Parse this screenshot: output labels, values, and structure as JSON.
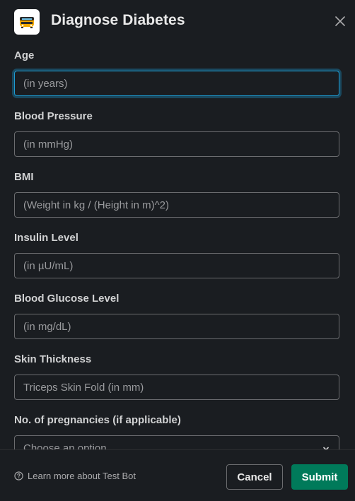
{
  "header": {
    "title": "Diagnose Diabetes",
    "app_icon": "bus-icon",
    "close_icon": "close-icon"
  },
  "fields": [
    {
      "label": "Age",
      "placeholder": "(in years)"
    },
    {
      "label": "Blood Pressure",
      "placeholder": "(in mmHg)"
    },
    {
      "label": "BMI",
      "placeholder": "(Weight in kg / (Height in m)^2)"
    },
    {
      "label": "Insulin Level",
      "placeholder": "(in µU/mL)"
    },
    {
      "label": "Blood Glucose Level",
      "placeholder": "(in mg/dL)"
    },
    {
      "label": "Skin Thickness",
      "placeholder": "Triceps Skin Fold (in mm)"
    }
  ],
  "pregnancies": {
    "label": "No. of pregnancies (if applicable)",
    "placeholder": "Choose an option…"
  },
  "footer": {
    "learn_more": "Learn more about Test Bot",
    "cancel": "Cancel",
    "submit": "Submit"
  },
  "colors": {
    "background": "#1a1d21",
    "focus": "#1d9bd1",
    "submit": "#007a5a"
  }
}
